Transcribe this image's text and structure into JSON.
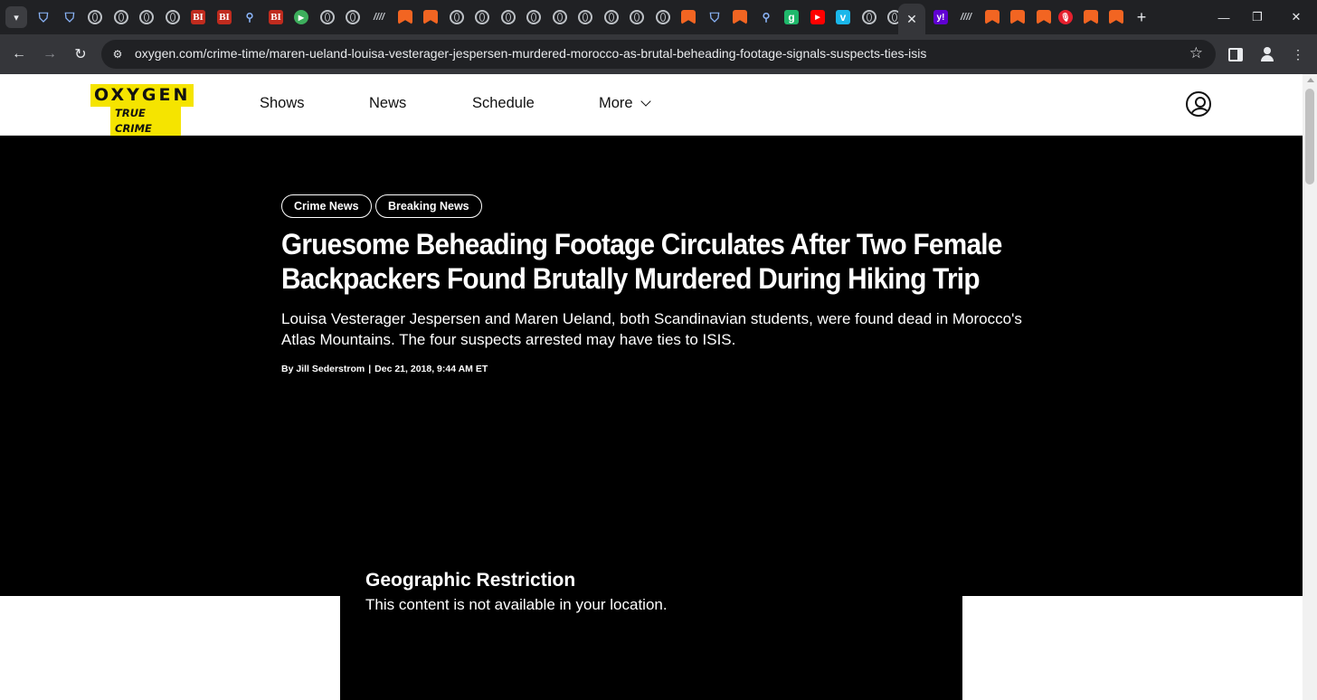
{
  "browser": {
    "tab_search_icon": "chevron-down-icon",
    "new_tab_label": "+",
    "active_tab_close": "✕",
    "window_controls": {
      "minimize": "—",
      "restore": "❐",
      "close": "✕"
    },
    "url": "oxygen.com/crime-time/maren-ueland-louisa-vesterager-jespersen-murdered-morocco-as-brutal-beheading-footage-signals-suspects-ties-isis",
    "nav": {
      "back": "←",
      "forward": "→",
      "reload": "↻"
    },
    "bookmark_icon": "☆"
  },
  "site": {
    "logo_top": "OXYGEN",
    "logo_bottom": "TRUE CRIME",
    "nav": {
      "shows": "Shows",
      "news": "News",
      "schedule": "Schedule",
      "more": "More"
    }
  },
  "article": {
    "tags": [
      "Crime News",
      "Breaking News"
    ],
    "headline": "Gruesome Beheading Footage Circulates After Two Female Backpackers Found Brutally Murdered During Hiking Trip",
    "dek": "Louisa Vesterager Jespersen and Maren Ueland, both Scandinavian students, were found dead in Morocco's Atlas Mountains. The four suspects arrested may have ties to ISIS.",
    "author": "By Jill Sederstrom",
    "separator": "|",
    "date": "Dec 21, 2018, 9:44 AM ET"
  },
  "video": {
    "restriction_title": "Geographic Restriction",
    "restriction_message": "This content is not available in your location."
  }
}
